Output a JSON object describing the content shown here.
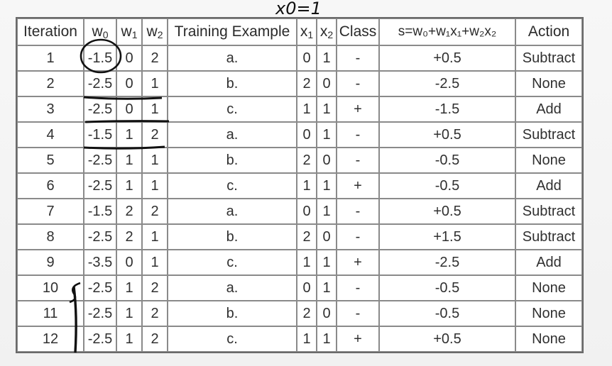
{
  "annotation": {
    "x0_note": "x0=1"
  },
  "table": {
    "headers": {
      "iteration": "Iteration",
      "w0": "w",
      "w0_sub": "0",
      "w1": "w",
      "w1_sub": "1",
      "w2": "w",
      "w2_sub": "2",
      "training_example": "Training Example",
      "x1": "x",
      "x1_sub": "1",
      "x2": "x",
      "x2_sub": "2",
      "class": "Class",
      "s": "s=w₀+w₁x₁+w₂x₂",
      "action": "Action"
    },
    "rows": [
      {
        "iteration": "1",
        "w0": "-1.5",
        "w1": "0",
        "w2": "2",
        "example": "a.",
        "x1": "0",
        "x2": "1",
        "cls": "-",
        "s": "+0.5",
        "action": "Subtract"
      },
      {
        "iteration": "2",
        "w0": "-2.5",
        "w1": "0",
        "w2": "1",
        "example": "b.",
        "x1": "2",
        "x2": "0",
        "cls": "-",
        "s": "-2.5",
        "action": "None"
      },
      {
        "iteration": "3",
        "w0": "-2.5",
        "w1": "0",
        "w2": "1",
        "example": "c.",
        "x1": "1",
        "x2": "1",
        "cls": "+",
        "s": "-1.5",
        "action": "Add"
      },
      {
        "iteration": "4",
        "w0": "-1.5",
        "w1": "1",
        "w2": "2",
        "example": "a.",
        "x1": "0",
        "x2": "1",
        "cls": "-",
        "s": "+0.5",
        "action": "Subtract"
      },
      {
        "iteration": "5",
        "w0": "-2.5",
        "w1": "1",
        "w2": "1",
        "example": "b.",
        "x1": "2",
        "x2": "0",
        "cls": "-",
        "s": "-0.5",
        "action": "None"
      },
      {
        "iteration": "6",
        "w0": "-2.5",
        "w1": "1",
        "w2": "1",
        "example": "c.",
        "x1": "1",
        "x2": "1",
        "cls": "+",
        "s": "-0.5",
        "action": "Add"
      },
      {
        "iteration": "7",
        "w0": "-1.5",
        "w1": "2",
        "w2": "2",
        "example": "a.",
        "x1": "0",
        "x2": "1",
        "cls": "-",
        "s": "+0.5",
        "action": "Subtract"
      },
      {
        "iteration": "8",
        "w0": "-2.5",
        "w1": "2",
        "w2": "1",
        "example": "b.",
        "x1": "2",
        "x2": "0",
        "cls": "-",
        "s": "+1.5",
        "action": "Subtract"
      },
      {
        "iteration": "9",
        "w0": "-3.5",
        "w1": "0",
        "w2": "1",
        "example": "c.",
        "x1": "1",
        "x2": "1",
        "cls": "+",
        "s": "-2.5",
        "action": "Add"
      },
      {
        "iteration": "10",
        "w0": "-2.5",
        "w1": "1",
        "w2": "2",
        "example": "a.",
        "x1": "0",
        "x2": "1",
        "cls": "-",
        "s": "-0.5",
        "action": "None"
      },
      {
        "iteration": "11",
        "w0": "-2.5",
        "w1": "1",
        "w2": "2",
        "example": "b.",
        "x1": "2",
        "x2": "0",
        "cls": "-",
        "s": "-0.5",
        "action": "None"
      },
      {
        "iteration": "12",
        "w0": "-2.5",
        "w1": "1",
        "w2": "2",
        "example": "c.",
        "x1": "1",
        "x2": "1",
        "cls": "+",
        "s": "+0.5",
        "action": "None"
      }
    ]
  },
  "colors": {
    "ink": "#111111",
    "x2_digit": "#2060c0",
    "grid": "#8a8a8a"
  }
}
